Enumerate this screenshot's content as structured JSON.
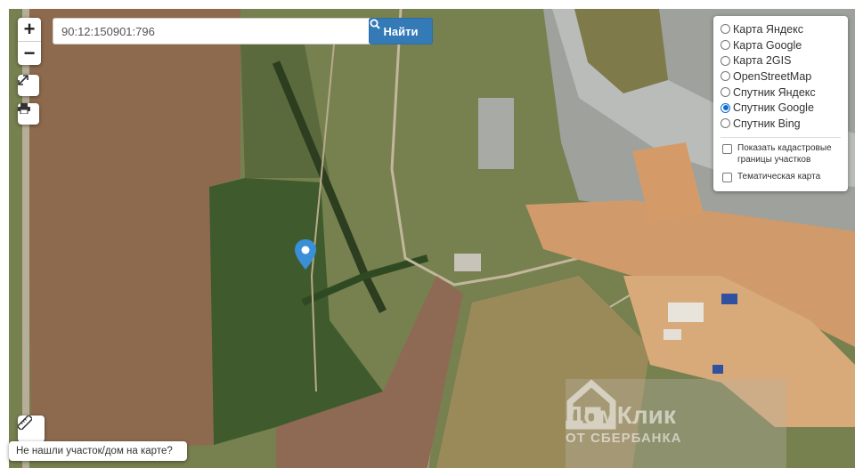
{
  "search": {
    "value": "90:12:150901:796",
    "button_label": "Найти",
    "button_icon": "search-icon"
  },
  "zoom": {
    "in_label": "+",
    "out_label": "−"
  },
  "tools": {
    "fullscreen_icon": "expand-icon",
    "print_icon": "print-icon",
    "ruler_icon": "ruler-icon"
  },
  "layers": {
    "options": [
      {
        "label": "Карта Яндекс",
        "selected": false
      },
      {
        "label": "Карта Google",
        "selected": false
      },
      {
        "label": "Карта 2GIS",
        "selected": false
      },
      {
        "label": "OpenStreetMap",
        "selected": false
      },
      {
        "label": "Спутник Яндекс",
        "selected": false
      },
      {
        "label": "Спутник Google",
        "selected": true
      },
      {
        "label": "Спутник Bing",
        "selected": false
      }
    ],
    "checkboxes": [
      {
        "label": "Показать кадастровые границы участков",
        "checked": false
      },
      {
        "label": "Тематическая карта",
        "checked": false
      }
    ]
  },
  "not_found_link": "Не нашли участок/дом на карте?",
  "watermark": {
    "line1": "ДомКлик",
    "line2": "ОТ СБЕРБАНКА"
  },
  "marker_color": "#3a8fd6",
  "accent_color": "#337ab7"
}
